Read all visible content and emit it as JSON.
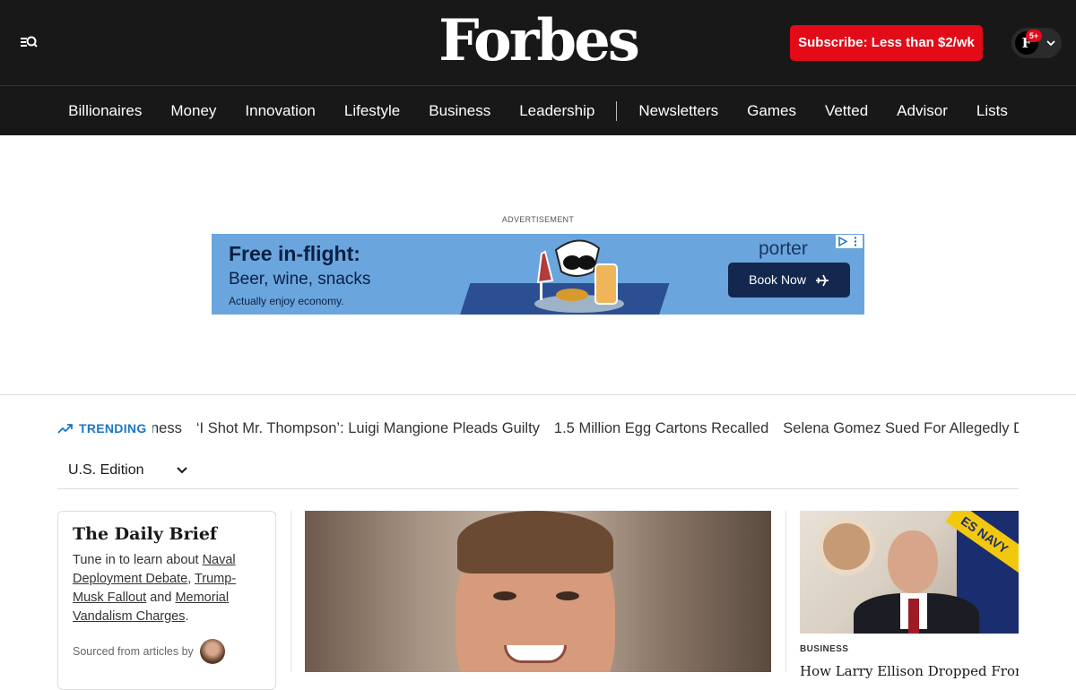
{
  "header": {
    "logo": "Forbes",
    "subscribe_label": "Subscribe: Less than $2/wk",
    "account_initial": "F",
    "notification_badge": "5+",
    "icons": [
      "menu-search-icon",
      "chevron-down-icon"
    ],
    "colors": {
      "background": "#181818",
      "subscribe": "#e30b17"
    }
  },
  "nav": {
    "items": [
      "Billionaires",
      "Money",
      "Innovation",
      "Lifestyle",
      "Business",
      "Leadership"
    ],
    "items_right": [
      "Newsletters",
      "Games",
      "Vetted",
      "Advisor",
      "Lists"
    ]
  },
  "ad": {
    "label": "ADVERTISEMENT",
    "headline": "Free in-flight:",
    "subline": "Beer, wine, snacks",
    "tagline": "Actually enjoy economy.",
    "brand": "porter",
    "cta": "Book Now"
  },
  "trending": {
    "label": "TRENDING",
    "items": [
      "ness",
      "‘I Shot Mr. Thompson’: Luigi Mangione Pleads Guilty",
      "1.5 Million Egg Cartons Recalled",
      "Selena Gomez Sued For Allegedly D"
    ]
  },
  "edition": {
    "selected": "U.S. Edition"
  },
  "daily_brief": {
    "title": "The Daily Brief",
    "intro": "Tune in to learn about ",
    "link1": "Naval Deployment Debate",
    "sep1": ", ",
    "link2": "Trump-Musk Fallout",
    "sep2": " and ",
    "link3": "Memorial Vandalism Charges",
    "end": ".",
    "sourced": "Sourced from articles by"
  },
  "right_card": {
    "category": "BUSINESS",
    "title": "How Larry Ellison Dropped From",
    "flag_text": "ES NAVY"
  }
}
